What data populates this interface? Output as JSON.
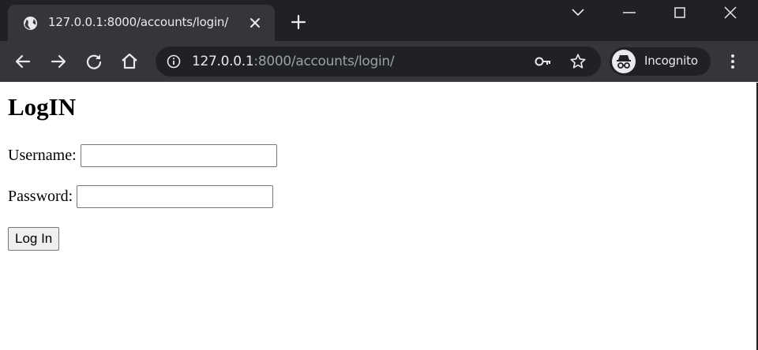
{
  "browser": {
    "tab": {
      "title": "127.0.0.1:8000/accounts/login/"
    },
    "address_bar": {
      "host": "127.0.0.1",
      "path": ":8000/accounts/login/"
    },
    "incognito_label": "Incognito",
    "icons": [
      "globe-icon",
      "close-icon",
      "plus-icon",
      "chevron-down-icon",
      "minimize-icon",
      "maximize-icon",
      "window-close-icon",
      "back-arrow-icon",
      "forward-arrow-icon",
      "reload-icon",
      "home-icon",
      "info-icon",
      "key-icon",
      "star-icon",
      "incognito-icon",
      "kebab-menu-icon"
    ],
    "colors": {
      "titlebar": "#202124",
      "toolbar": "#35363a",
      "text": "#e8eaed",
      "muted": "#9aa0a6"
    }
  },
  "page": {
    "heading": "LogIN",
    "username_label": "Username:",
    "username_value": "",
    "password_label": "Password:",
    "password_value": "",
    "submit_label": "Log In"
  }
}
